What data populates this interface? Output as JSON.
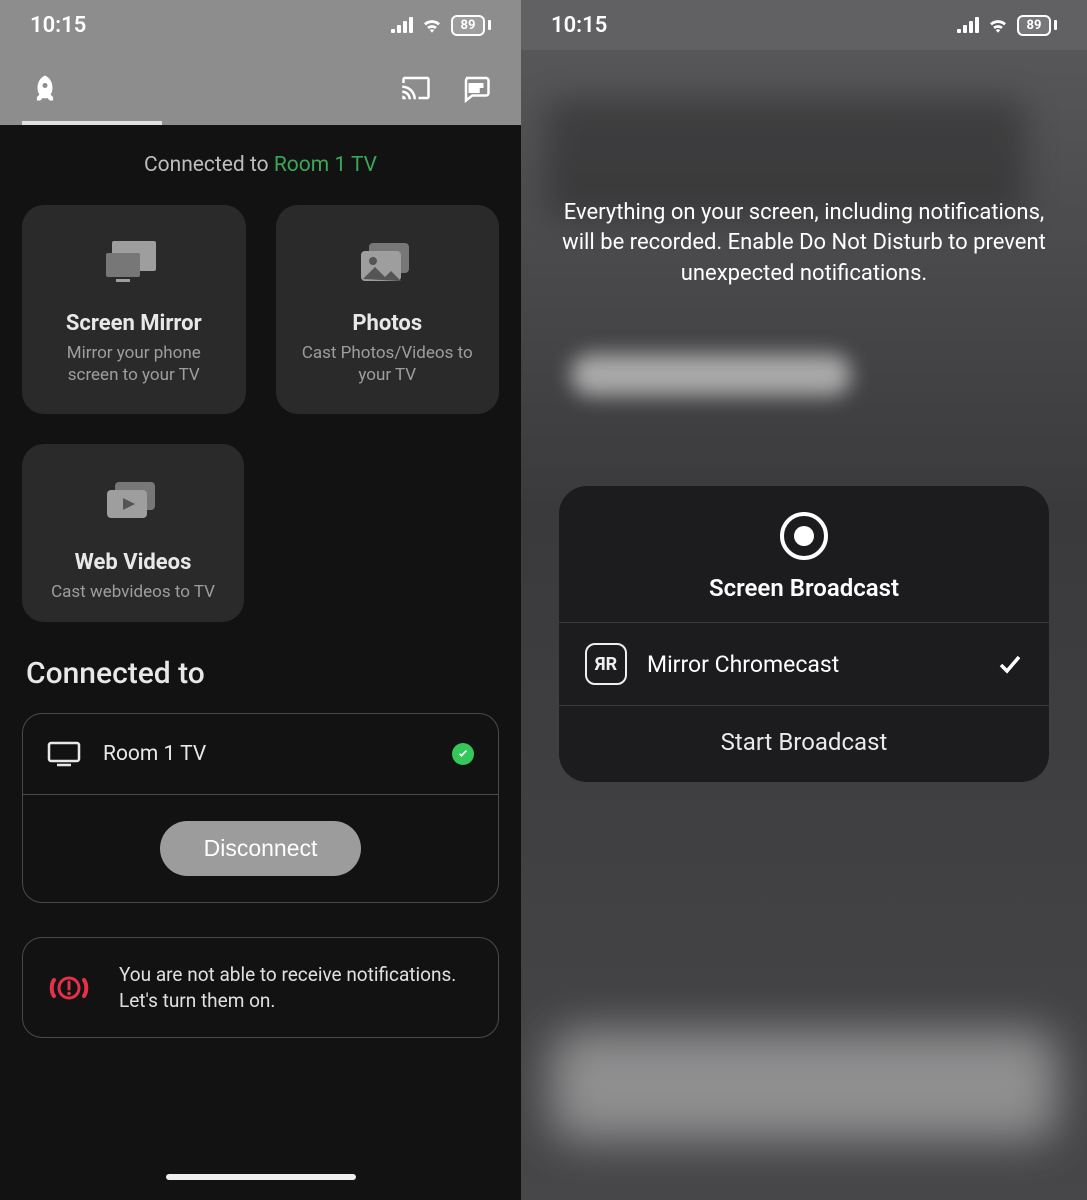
{
  "left": {
    "status": {
      "time": "10:15",
      "battery": "89"
    },
    "connected_line_prefix": "Connected to ",
    "connected_line_device": "Room 1 TV",
    "tiles": [
      {
        "title": "Screen Mirror",
        "sub": "Mirror your phone screen to your TV"
      },
      {
        "title": "Photos",
        "sub": "Cast Photos/Videos to your TV"
      },
      {
        "title": "Web Videos",
        "sub": "Cast webvideos to TV"
      }
    ],
    "section_heading": "Connected to",
    "device_name": "Room 1 TV",
    "disconnect_label": "Disconnect",
    "notif_text": "You are not able to receive notifications. Let's turn them on."
  },
  "right": {
    "status": {
      "time": "10:15",
      "battery": "89"
    },
    "warning": "Everything on your screen, including notifications, will be recorded. Enable Do Not Disturb to prevent unexpected notifications.",
    "broadcast": {
      "title": "Screen Broadcast",
      "app_glyph": "ЯR",
      "app_name": "Mirror Chromecast",
      "start_label": "Start Broadcast"
    }
  }
}
